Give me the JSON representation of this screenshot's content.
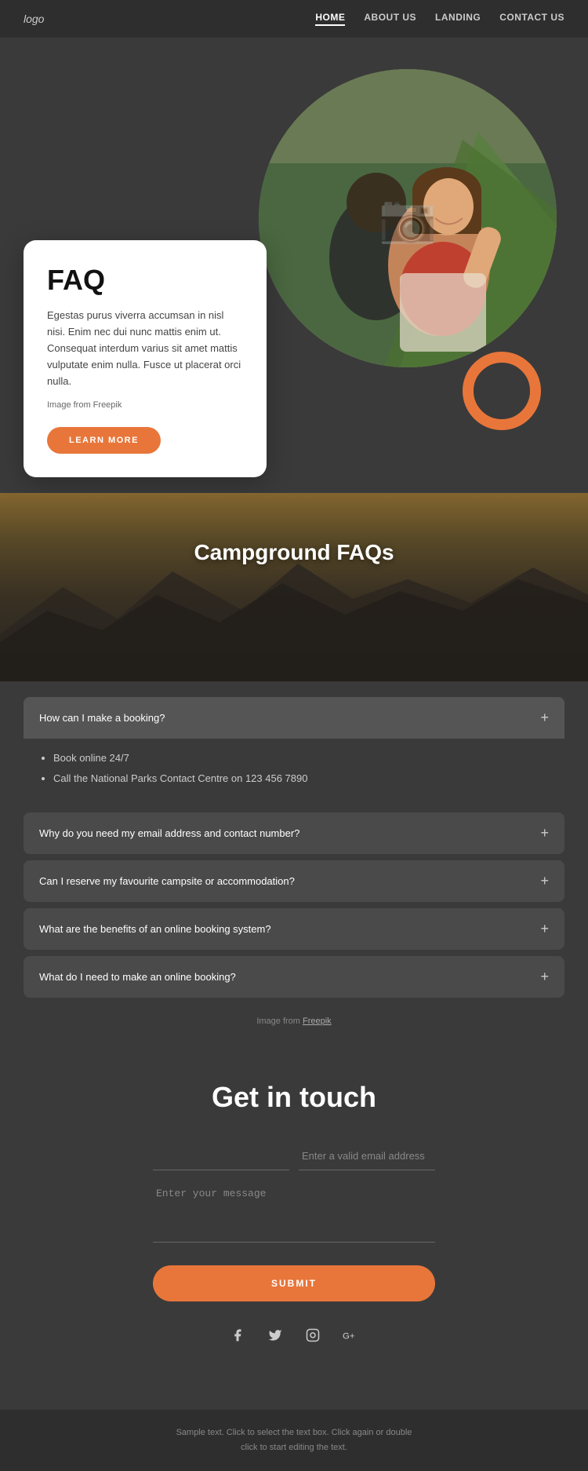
{
  "nav": {
    "logo": "logo",
    "links": [
      {
        "label": "HOME",
        "active": true
      },
      {
        "label": "ABOUT US",
        "active": false
      },
      {
        "label": "LANDING",
        "active": false
      },
      {
        "label": "CONTACT US",
        "active": false
      }
    ]
  },
  "hero": {
    "faq_title": "FAQ",
    "faq_body": "Egestas purus viverra accumsan in nisl nisi. Enim nec dui nunc mattis enim ut. Consequat interdum varius sit amet mattis vulputate enim nulla. Fusce ut placerat orci nulla.",
    "image_credit": "Image from Freepik",
    "learn_more": "LEARN MORE"
  },
  "campground": {
    "title": "Campground FAQs",
    "faqs": [
      {
        "question": "How can I make a booking?",
        "answer_items": [
          "Book online 24/7",
          "Call the National Parks Contact Centre on 123 456 7890"
        ],
        "open": true
      },
      {
        "question": "Why do you need my email address and contact number?",
        "open": false
      },
      {
        "question": "Can I reserve my favourite campsite or accommodation?",
        "open": false
      },
      {
        "question": "What are the benefits of an online booking system?",
        "open": false
      },
      {
        "question": "What do I need to make an online booking?",
        "open": false
      }
    ],
    "image_credit": "Image from ",
    "image_credit_link": "Freepik"
  },
  "contact": {
    "title": "Get in touch",
    "name_placeholder": "",
    "email_placeholder": "Enter a valid email address",
    "message_placeholder": "Enter your message",
    "submit_label": "SUBMIT"
  },
  "social": {
    "icons": [
      "f",
      "t",
      "inst",
      "g+"
    ]
  },
  "footer": {
    "text": "Sample text. Click to select the text box. Click again or double",
    "text2": "click to start editing the text."
  }
}
